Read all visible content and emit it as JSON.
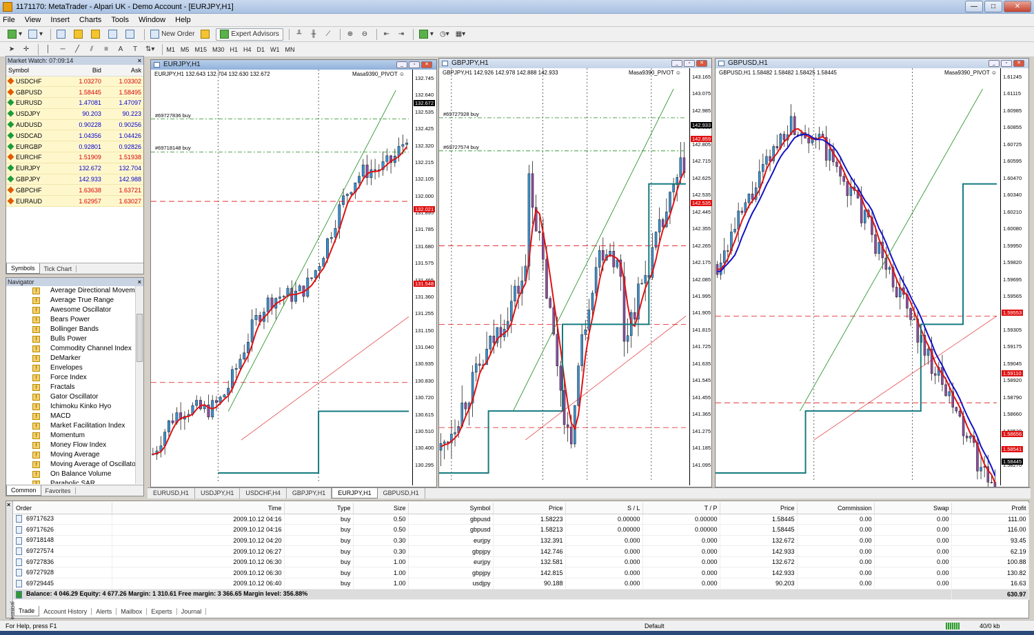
{
  "window": {
    "title": "1171170: MetaTrader - Alpari UK - Demo Account - [EURJPY,H1]",
    "min": "—",
    "max": "□",
    "close": "✕"
  },
  "menu": [
    "File",
    "View",
    "Insert",
    "Charts",
    "Tools",
    "Window",
    "Help"
  ],
  "toolbar": {
    "new_order": "New Order",
    "expert_advisors": "Expert Advisors",
    "timeframes": [
      "M1",
      "M5",
      "M15",
      "M30",
      "H1",
      "H4",
      "D1",
      "W1",
      "MN"
    ]
  },
  "market_watch": {
    "title": "Market Watch: 07:09:14",
    "cols": {
      "symbol": "Symbol",
      "bid": "Bid",
      "ask": "Ask"
    },
    "rows": [
      {
        "symbol": "USDCHF",
        "bid": "1.03270",
        "ask": "1.03302",
        "dir": "down"
      },
      {
        "symbol": "GBPUSD",
        "bid": "1.58445",
        "ask": "1.58495",
        "dir": "down"
      },
      {
        "symbol": "EURUSD",
        "bid": "1.47081",
        "ask": "1.47097",
        "dir": "up"
      },
      {
        "symbol": "USDJPY",
        "bid": "90.203",
        "ask": "90.223",
        "dir": "up"
      },
      {
        "symbol": "AUDUSD",
        "bid": "0.90228",
        "ask": "0.90256",
        "dir": "up"
      },
      {
        "symbol": "USDCAD",
        "bid": "1.04356",
        "ask": "1.04426",
        "dir": "up"
      },
      {
        "symbol": "EURGBP",
        "bid": "0.92801",
        "ask": "0.92826",
        "dir": "up"
      },
      {
        "symbol": "EURCHF",
        "bid": "1.51909",
        "ask": "1.51938",
        "dir": "down"
      },
      {
        "symbol": "EURJPY",
        "bid": "132.672",
        "ask": "132.704",
        "dir": "up"
      },
      {
        "symbol": "GBPJPY",
        "bid": "142.933",
        "ask": "142.988",
        "dir": "up"
      },
      {
        "symbol": "GBPCHF",
        "bid": "1.63638",
        "ask": "1.63721",
        "dir": "down"
      },
      {
        "symbol": "EURAUD",
        "bid": "1.62957",
        "ask": "1.63027",
        "dir": "down"
      }
    ],
    "tabs": [
      "Symbols",
      "Tick Chart"
    ]
  },
  "navigator": {
    "title": "Navigator",
    "items": [
      "Average Directional Movement",
      "Average True Range",
      "Awesome Oscillator",
      "Bears Power",
      "Bollinger Bands",
      "Bulls Power",
      "Commodity Channel Index",
      "DeMarker",
      "Envelopes",
      "Force Index",
      "Fractals",
      "Gator Oscillator",
      "Ichimoku Kinko Hyo",
      "MACD",
      "Market Facilitation Index",
      "Momentum",
      "Money Flow Index",
      "Moving Average",
      "Moving Average of Oscillator",
      "On Balance Volume",
      "Parabolic SAR"
    ],
    "tabs": [
      "Common",
      "Favorites"
    ]
  },
  "charts": [
    {
      "title": "EURJPY,H1",
      "info": "EURJPY,H1  132.643 132.704 132.630 132.672",
      "indicator": "Masa9390_PIVOT ☺",
      "prices": [
        "132.745",
        "132.640",
        "132.535",
        "132.425",
        "132.320",
        "132.215",
        "132.105",
        "132.000",
        "131.895",
        "131.785",
        "131.680",
        "131.575",
        "131.465",
        "131.360",
        "131.255",
        "131.150",
        "131.040",
        "130.935",
        "130.830",
        "130.720",
        "130.615",
        "130.510",
        "130.400",
        "130.295"
      ],
      "boxes": [
        {
          "label": "132.672",
          "color": "#000000"
        },
        {
          "label": "132.021",
          "color": "#e01010"
        },
        {
          "label": "131.548",
          "color": "#e01010"
        }
      ],
      "orders": [
        "#69727836 buy",
        "#69718148 buy"
      ]
    },
    {
      "title": "GBPJPY,H1",
      "info": "GBPJPY,H1  142.926 142.978 142.888 142.933",
      "indicator": "Masa9390_PIVOT ☺",
      "prices": [
        "143.165",
        "143.075",
        "142.985",
        "142.895",
        "142.805",
        "142.715",
        "142.625",
        "142.535",
        "142.445",
        "142.355",
        "142.265",
        "142.175",
        "142.085",
        "141.995",
        "141.905",
        "141.815",
        "141.725",
        "141.635",
        "141.545",
        "141.455",
        "141.365",
        "141.275",
        "141.185",
        "141.095"
      ],
      "boxes": [
        {
          "label": "142.933",
          "color": "#000000"
        },
        {
          "label": "142.859",
          "color": "#e01010"
        },
        {
          "label": "142.535",
          "color": "#e01010"
        }
      ],
      "orders": [
        "#69727928 buy",
        "#69727574 buy"
      ]
    },
    {
      "title": "GBPUSD,H1",
      "info": "GBPUSD,H1  1.58482 1.58482 1.58425 1.58445",
      "indicator": "Masa9390_PIVOT ☺",
      "prices": [
        "1.61245",
        "1.61115",
        "1.60985",
        "1.60855",
        "1.60725",
        "1.60595",
        "1.60470",
        "1.60340",
        "1.60210",
        "1.60080",
        "1.59950",
        "1.59820",
        "1.59695",
        "1.59565",
        "1.59435",
        "1.59305",
        "1.59175",
        "1.59045",
        "1.58920",
        "1.58790",
        "1.58660",
        "1.58530",
        "1.58400",
        "1.58270"
      ],
      "boxes": [
        {
          "label": "1.59553",
          "color": "#e01010"
        },
        {
          "label": "1.59110",
          "color": "#e01010"
        },
        {
          "label": "1.58656",
          "color": "#e01010"
        },
        {
          "label": "1.58541",
          "color": "#e01010"
        },
        {
          "label": "1.58445",
          "color": "#000000"
        }
      ],
      "orders": []
    }
  ],
  "chart_tabs": [
    "EURUSD,H1",
    "USDJPY,H1",
    "USDCHF,H4",
    "GBPJPY,H1",
    "EURJPY,H1",
    "GBPUSD,H1"
  ],
  "terminal": {
    "label": "Terminal",
    "cols": [
      "Order",
      "Time",
      "Type",
      "Size",
      "Symbol",
      "Price",
      "S / L",
      "T / P",
      "Price",
      "Commission",
      "Swap",
      "Profit"
    ],
    "rows": [
      [
        "69717623",
        "2009.10.12 04:16",
        "buy",
        "0.50",
        "gbpusd",
        "1.58223",
        "0.00000",
        "0.00000",
        "1.58445",
        "0.00",
        "0.00",
        "111.00"
      ],
      [
        "69717626",
        "2009.10.12 04:16",
        "buy",
        "0.50",
        "gbpusd",
        "1.58213",
        "0.00000",
        "0.00000",
        "1.58445",
        "0.00",
        "0.00",
        "116.00"
      ],
      [
        "69718148",
        "2009.10.12 04:20",
        "buy",
        "0.30",
        "eurjpy",
        "132.391",
        "0.000",
        "0.000",
        "132.672",
        "0.00",
        "0.00",
        "93.45"
      ],
      [
        "69727574",
        "2009.10.12 06:27",
        "buy",
        "0.30",
        "gbpjpy",
        "142.746",
        "0.000",
        "0.000",
        "142.933",
        "0.00",
        "0.00",
        "62.19"
      ],
      [
        "69727836",
        "2009.10.12 06:30",
        "buy",
        "1.00",
        "eurjpy",
        "132.581",
        "0.000",
        "0.000",
        "132.672",
        "0.00",
        "0.00",
        "100.88"
      ],
      [
        "69727928",
        "2009.10.12 06:30",
        "buy",
        "1.00",
        "gbpjpy",
        "142.815",
        "0.000",
        "0.000",
        "142.933",
        "0.00",
        "0.00",
        "130.82"
      ],
      [
        "69729445",
        "2009.10.12 06:40",
        "buy",
        "1.00",
        "usdjpy",
        "90.188",
        "0.000",
        "0.000",
        "90.203",
        "0.00",
        "0.00",
        "16.63"
      ]
    ],
    "summary": "Balance: 4 046.29  Equity: 4 677.26  Margin: 1 310.61  Free margin: 3 366.65  Margin level: 356.88%",
    "total_profit": "630.97",
    "tabs": [
      "Trade",
      "Account History",
      "Alerts",
      "Mailbox",
      "Experts",
      "Journal"
    ]
  },
  "status": {
    "help": "For Help, press F1",
    "profile": "Default",
    "traffic": "40/0 kb"
  }
}
